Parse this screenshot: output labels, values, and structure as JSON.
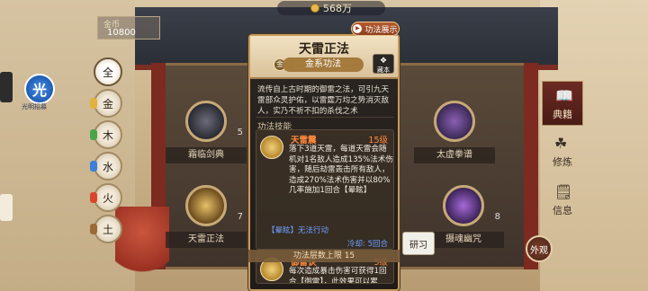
{
  "top_currency": {
    "value": "568万",
    "icon": "coin-icon"
  },
  "gold_box": {
    "label": "金币",
    "value": "10800"
  },
  "sun_badge": {
    "glyph": "光",
    "label": "光明招募"
  },
  "filters": [
    {
      "label": "全",
      "active": true
    },
    {
      "label": "金",
      "active": false
    },
    {
      "label": "木",
      "active": false
    },
    {
      "label": "水",
      "active": false
    },
    {
      "label": "火",
      "active": false
    },
    {
      "label": "土",
      "active": false
    }
  ],
  "tiles": [
    {
      "name": "霜临剑典",
      "num": "5"
    },
    {
      "name": "太虚拳谱",
      "num": ""
    },
    {
      "name": "天雷正法",
      "num": "7"
    },
    {
      "name": "摄魂幽咒",
      "num": "8"
    }
  ],
  "right_tabs": [
    {
      "label": "典籍",
      "icon": "book-icon"
    },
    {
      "label": "修炼",
      "icon": "meditate-icon"
    },
    {
      "label": "信息",
      "icon": "info-icon"
    }
  ],
  "outer_btn": "外观",
  "popup": {
    "title": "天雷正法",
    "demo_label": "功法展示",
    "category": "金系功法",
    "category_icon": "金",
    "grade": "藏本",
    "description": "流传自上古时期的御雷之法，可引九天雷部众灵护佑，以雷霆万均之势消灭敌人，实乃不祈不扣的杀伐之术",
    "section_title": "功法技能",
    "skills": [
      {
        "name": "天雷震",
        "level": "15级",
        "text": "落下3道天雷，每道天雷会随机对1名敌人造成135%法术伤害，随后劫雷轰击所有敌人，造成270%法术伤害并以80%几率施加1回合【晕眩】",
        "tag": "【晕眩】无法行动",
        "cooldown": "冷却: 5回合"
      },
      {
        "name": "御雷诀",
        "level": "5级",
        "text": "每次造成暴击伤害可获得1回合【御雷】，此效果可以累"
      }
    ],
    "limit": "功法层数上限 15"
  },
  "research_label": "研习"
}
